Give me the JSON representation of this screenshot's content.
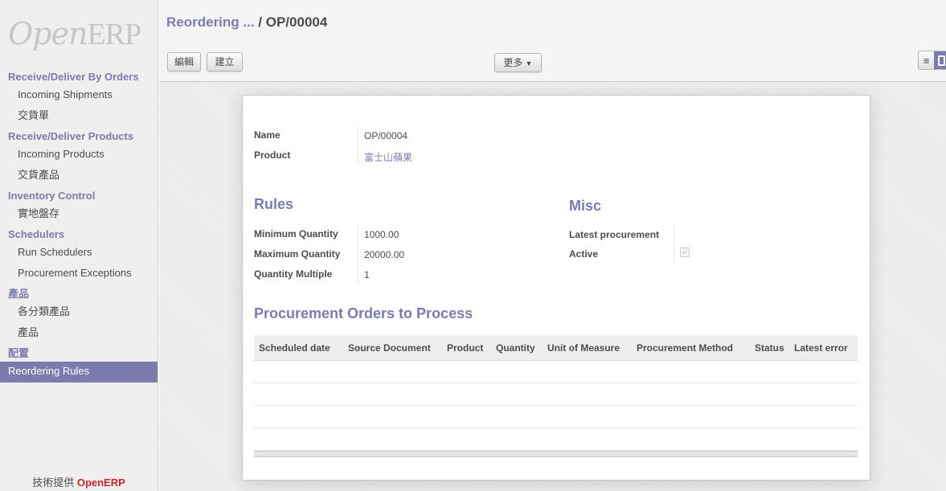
{
  "logo": {
    "open": "Open",
    "erp": "ERP"
  },
  "sidebar": {
    "sections": [
      {
        "head": "Receive/Deliver By Orders",
        "items": [
          "Incoming Shipments",
          "交貨單"
        ]
      },
      {
        "head": "Receive/Deliver Products",
        "items": [
          "Incoming Products",
          "交貨產品"
        ]
      },
      {
        "head": "Inventory Control",
        "items": [
          "實地盤存"
        ]
      },
      {
        "head": "Schedulers",
        "items": [
          "Run Schedulers",
          "Procurement Exceptions"
        ]
      },
      {
        "head": "產品",
        "items": [
          "各分類產品",
          "產品"
        ]
      },
      {
        "head": "配置",
        "items": [
          "Reordering Rules"
        ]
      }
    ],
    "footer_prefix": "技術提供",
    "footer_brand": "OpenERP"
  },
  "header": {
    "breadcrumb_parent": "Reordering ...",
    "breadcrumb_sep": " / ",
    "breadcrumb_current": "OP/00004",
    "edit_label": "編輯",
    "create_label": "建立",
    "more_label": "更多"
  },
  "form": {
    "name_label": "Name",
    "name_value": "OP/00004",
    "product_label": "Product",
    "product_value": "富士山蘋果",
    "rules_title": "Rules",
    "min_qty_label": "Minimum Quantity",
    "min_qty_value": "1000.00",
    "max_qty_label": "Maximum Quantity",
    "max_qty_value": "20000.00",
    "qty_multiple_label": "Quantity Multiple",
    "qty_multiple_value": "1",
    "misc_title": "Misc",
    "latest_proc_label": "Latest procurement",
    "active_label": "Active",
    "active_checked": true,
    "proc_title": "Procurement Orders to Process",
    "columns": [
      "Scheduled date",
      "Source Document",
      "Product",
      "Quantity",
      "Unit of Measure",
      "Procurement Method",
      "Status",
      "Latest error"
    ]
  },
  "colors": {
    "accent": "#7c7bad",
    "brand_red": "#c0282d"
  }
}
